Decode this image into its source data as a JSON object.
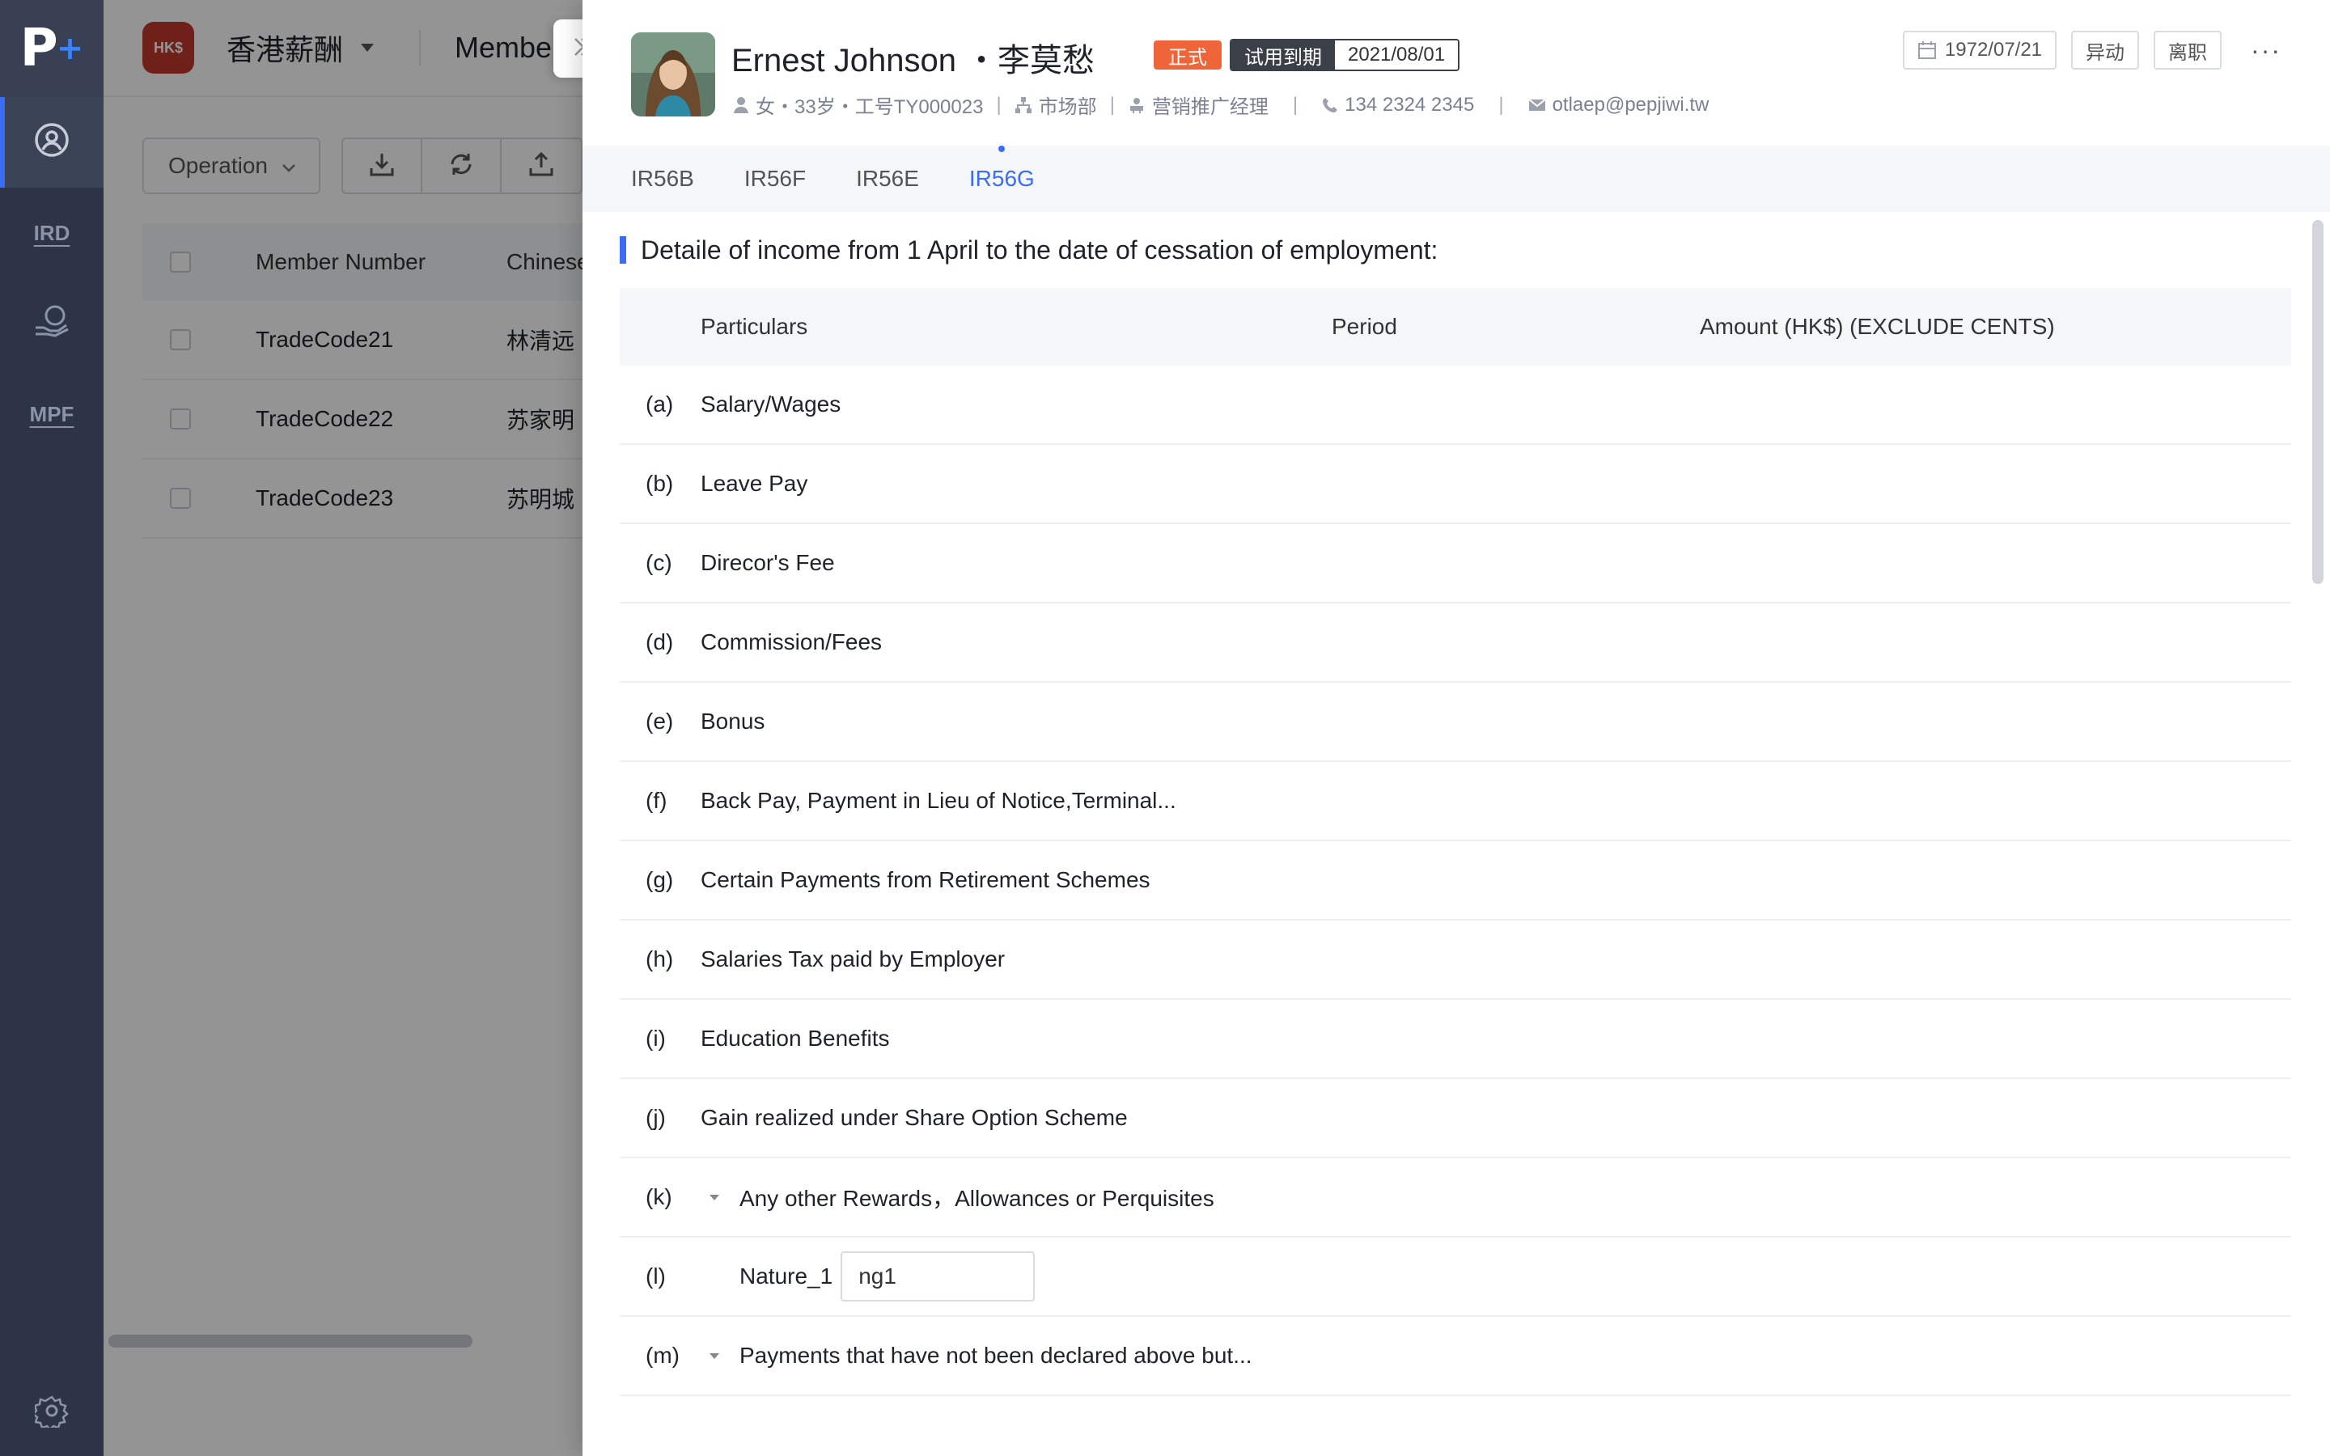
{
  "nav": {
    "logo": "P",
    "logo_plus": "+",
    "items": [
      {
        "key": "profile",
        "icon": "user-circle-icon",
        "active": true
      },
      {
        "key": "ird",
        "label": "IRD"
      },
      {
        "key": "payroll",
        "icon": "hand-coin-icon"
      },
      {
        "key": "mpf",
        "label": "MPF"
      }
    ],
    "settings_icon": "gear-icon"
  },
  "topbar": {
    "brand_badge": "HK$",
    "brand_name": "香港薪酬",
    "title": "Member"
  },
  "toolbar": {
    "operation_label": "Operation",
    "icons": [
      "download-icon",
      "refresh-icon",
      "upload-icon"
    ]
  },
  "grid": {
    "columns": [
      "Member Number",
      "Chinese"
    ],
    "rows": [
      {
        "number": "TradeCode21",
        "chinese": "林清远"
      },
      {
        "number": "TradeCode22",
        "chinese": "苏家明"
      },
      {
        "number": "TradeCode23",
        "chinese": "苏明城"
      }
    ]
  },
  "employee": {
    "name": "Ernest Johnson ・李莫愁",
    "status_tag": "正式",
    "probation_label": "试用到期",
    "probation_date": "2021/08/01",
    "gender_age": "女・33岁・工号TY000023",
    "department": "市场部",
    "position": "营销推广经理",
    "phone": "134 2324 2345",
    "email": "otlaep@pepjiwi.tw",
    "birth_date": "1972/07/21",
    "action_change": "异动",
    "action_leave": "离职",
    "more": "···"
  },
  "tabs": [
    {
      "label": "IR56B",
      "active": false
    },
    {
      "label": "IR56F",
      "active": false
    },
    {
      "label": "IR56E",
      "active": false
    },
    {
      "label": "IR56G",
      "active": true
    }
  ],
  "section": {
    "title": "Detaile of income from 1 April to the date of cessation of employment:",
    "columns": {
      "particulars": "Particulars",
      "period": "Period",
      "amount": "Amount (HK$) (EXCLUDE CENTS)"
    },
    "rows": [
      {
        "label": "(a)",
        "text": "Salary/Wages"
      },
      {
        "label": "(b)",
        "text": "Leave Pay"
      },
      {
        "label": "(c)",
        "text": "Direcor's Fee"
      },
      {
        "label": "(d)",
        "text": "Commission/Fees"
      },
      {
        "label": "(e)",
        "text": "Bonus"
      },
      {
        "label": "(f)",
        "text": "Back Pay, Payment in Lieu of Notice,Terminal..."
      },
      {
        "label": "(g)",
        "text": "Certain Payments from Retirement Schemes"
      },
      {
        "label": "(h)",
        "text": "Salaries Tax paid by Employer"
      },
      {
        "label": "(i)",
        "text": "Education Benefits"
      },
      {
        "label": "(j)",
        "text": "Gain realized under Share Option Scheme"
      },
      {
        "label": "(k)",
        "text": "Any other Rewards，Allowances or Perquisites"
      },
      {
        "label": "(l)",
        "text": "Nature_1",
        "input_value": "ng1"
      },
      {
        "label": "(m)",
        "text": "Payments that have not been declared above but..."
      }
    ]
  }
}
